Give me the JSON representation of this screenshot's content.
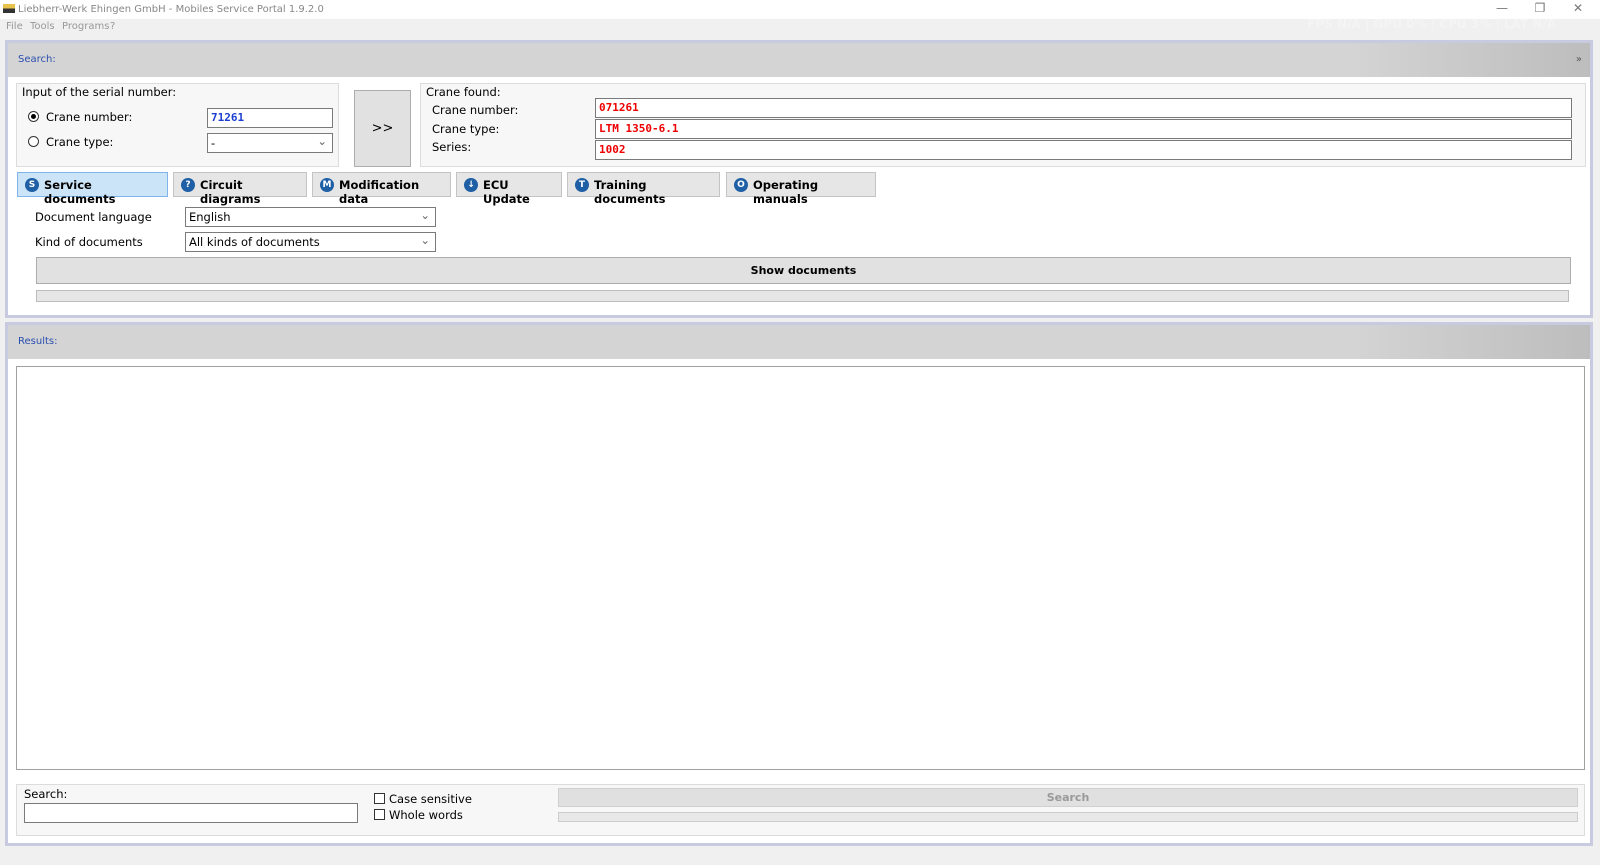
{
  "window": {
    "title": "Liebherr-Werk Ehingen GmbH - Mobiles Service Portal 1.9.2.0",
    "minimize": "—",
    "restore": "❐",
    "close": "✕"
  },
  "menu": [
    "File",
    "Tools",
    "Programs",
    "?"
  ],
  "overlay": "FPS N/A  |  GPU 0%  |  CPU 3%  |  LAT N/A",
  "search_panel": {
    "header": "Search:",
    "collapse_icon": "»",
    "serial": {
      "legend": "Input of the serial number:",
      "crane_number_label": "Crane number:",
      "crane_number_value": "71261",
      "crane_type_label": "Crane type:",
      "crane_type_value": "-"
    },
    "go_button": ">>",
    "found": {
      "legend": "Crane found:",
      "crane_number_label": "Crane number:",
      "crane_number_value": "071261",
      "crane_type_label": "Crane type:",
      "crane_type_value": "LTM 1350-6.1",
      "series_label": "Series:",
      "series_value": "1002"
    }
  },
  "tabs": [
    {
      "label": "Service documents",
      "icon": "S"
    },
    {
      "label": "Circuit diagrams",
      "icon": "?"
    },
    {
      "label": "Modification data",
      "icon": "M"
    },
    {
      "label": "ECU Update",
      "icon": "↓"
    },
    {
      "label": "Training documents",
      "icon": "T"
    },
    {
      "label": "Operating manuals",
      "icon": "O"
    }
  ],
  "service": {
    "language_label": "Document language",
    "language_value": "English",
    "kind_label": "Kind of documents",
    "kind_value": "All kinds of documents",
    "show_button": "Show documents",
    "progress": 0
  },
  "results": {
    "header": "Results:",
    "search_label": "Search:",
    "search_value": "",
    "case_sensitive": "Case sensitive",
    "whole_words": "Whole words",
    "search_button": "Search",
    "progress": 0
  }
}
